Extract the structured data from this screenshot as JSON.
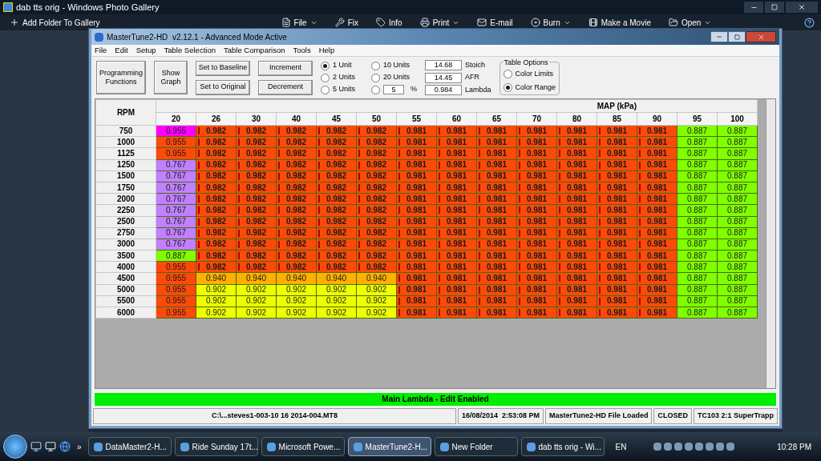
{
  "gallery": {
    "title": "dab tts orig - Windows Photo Gallery",
    "toolbar": [
      {
        "label": "Add Folder To Gallery",
        "kind": "add",
        "has_menu": false
      },
      {
        "label": "File",
        "kind": "file",
        "has_menu": true
      },
      {
        "label": "Fix",
        "kind": "fix",
        "has_menu": false
      },
      {
        "label": "Info",
        "kind": "info",
        "has_menu": false
      },
      {
        "label": "Print",
        "kind": "print",
        "has_menu": true
      },
      {
        "label": "E-mail",
        "kind": "mail",
        "has_menu": false
      },
      {
        "label": "Burn",
        "kind": "burn",
        "has_menu": true
      },
      {
        "label": "Make a Movie",
        "kind": "movie",
        "has_menu": false
      },
      {
        "label": "Open",
        "kind": "open",
        "has_menu": true
      }
    ]
  },
  "window": {
    "title": "MasterTune2-HD  v2.12.1 - Advanced Mode Active",
    "menu": [
      "File",
      "Edit",
      "Setup",
      "Table Selection",
      "Table Comparison",
      "Tools",
      "Help"
    ],
    "big_buttons": [
      "Programming Functions",
      "Show Graph"
    ],
    "buttons_a": [
      "Set to Baseline",
      "Set to Original"
    ],
    "buttons_b": [
      "Increment",
      "Decrement"
    ],
    "units": [
      {
        "label": "1 Unit",
        "selected": true
      },
      {
        "label": "2 Units",
        "selected": false
      },
      {
        "label": "5 Units",
        "selected": false
      },
      {
        "label": "10 Units",
        "selected": false
      },
      {
        "label": "20 Units",
        "selected": false
      }
    ],
    "percent": {
      "selected": false,
      "value": "5",
      "unit": "%"
    },
    "readouts": [
      {
        "value": "14.68",
        "label": "Stoich"
      },
      {
        "value": "14.45",
        "label": "AFR"
      },
      {
        "value": "0.984",
        "label": "Lambda"
      }
    ],
    "table_options": {
      "title": "Table Options",
      "options": [
        {
          "label": "Color Limits",
          "selected": false
        },
        {
          "label": "Color Range",
          "selected": true
        }
      ]
    }
  },
  "table": {
    "row_header": "RPM",
    "column_group": "MAP (kPa)",
    "columns": [
      "20",
      "26",
      "30",
      "40",
      "45",
      "50",
      "55",
      "60",
      "65",
      "70",
      "80",
      "85",
      "90",
      "95",
      "100"
    ],
    "rows": [
      {
        "rpm": "750",
        "cells": [
          {
            "value": "0.955",
            "color": "#ff00ff",
            "marked": false
          },
          {
            "value": "0.982",
            "color": "#fc4a0a",
            "marked": true
          },
          {
            "value": "0.982",
            "color": "#fc4a0a",
            "marked": true
          },
          {
            "value": "0.982",
            "color": "#fc4a0a",
            "marked": true
          },
          {
            "value": "0.982",
            "color": "#fc4a0a",
            "marked": true
          },
          {
            "value": "0.982",
            "color": "#fc4a0a",
            "marked": true
          },
          {
            "value": "0.981",
            "color": "#fc4a0a",
            "marked": true
          },
          {
            "value": "0.981",
            "color": "#fc4a0a",
            "marked": true
          },
          {
            "value": "0.981",
            "color": "#fc4a0a",
            "marked": true
          },
          {
            "value": "0.981",
            "color": "#fc4a0a",
            "marked": true
          },
          {
            "value": "0.981",
            "color": "#fc4a0a",
            "marked": true
          },
          {
            "value": "0.981",
            "color": "#fc4a0a",
            "marked": true
          },
          {
            "value": "0.981",
            "color": "#fc4a0a",
            "marked": true
          },
          {
            "value": "0.887",
            "color": "#80ff00",
            "marked": false
          },
          {
            "value": "0.887",
            "color": "#80ff00",
            "marked": false
          }
        ]
      },
      {
        "rpm": "1000",
        "cells": [
          {
            "value": "0.955",
            "color": "#fc4a0a",
            "marked": false
          },
          {
            "value": "0.982",
            "color": "#fc4a0a",
            "marked": true
          },
          {
            "value": "0.982",
            "color": "#fc4a0a",
            "marked": true
          },
          {
            "value": "0.982",
            "color": "#fc4a0a",
            "marked": true
          },
          {
            "value": "0.982",
            "color": "#fc4a0a",
            "marked": true
          },
          {
            "value": "0.982",
            "color": "#fc4a0a",
            "marked": true
          },
          {
            "value": "0.981",
            "color": "#fc4a0a",
            "marked": true
          },
          {
            "value": "0.981",
            "color": "#fc4a0a",
            "marked": true
          },
          {
            "value": "0.981",
            "color": "#fc4a0a",
            "marked": true
          },
          {
            "value": "0.981",
            "color": "#fc4a0a",
            "marked": true
          },
          {
            "value": "0.981",
            "color": "#fc4a0a",
            "marked": true
          },
          {
            "value": "0.981",
            "color": "#fc4a0a",
            "marked": true
          },
          {
            "value": "0.981",
            "color": "#fc4a0a",
            "marked": true
          },
          {
            "value": "0.887",
            "color": "#80ff00",
            "marked": false
          },
          {
            "value": "0.887",
            "color": "#80ff00",
            "marked": false
          }
        ]
      },
      {
        "rpm": "1125",
        "cells": [
          {
            "value": "0.955",
            "color": "#fc4a0a",
            "marked": false
          },
          {
            "value": "0.982",
            "color": "#fc4a0a",
            "marked": true
          },
          {
            "value": "0.982",
            "color": "#fc4a0a",
            "marked": true
          },
          {
            "value": "0.982",
            "color": "#fc4a0a",
            "marked": true
          },
          {
            "value": "0.982",
            "color": "#fc4a0a",
            "marked": true
          },
          {
            "value": "0.982",
            "color": "#fc4a0a",
            "marked": true
          },
          {
            "value": "0.981",
            "color": "#fc4a0a",
            "marked": true
          },
          {
            "value": "0.981",
            "color": "#fc4a0a",
            "marked": true
          },
          {
            "value": "0.981",
            "color": "#fc4a0a",
            "marked": true
          },
          {
            "value": "0.981",
            "color": "#fc4a0a",
            "marked": true
          },
          {
            "value": "0.981",
            "color": "#fc4a0a",
            "marked": true
          },
          {
            "value": "0.981",
            "color": "#fc4a0a",
            "marked": true
          },
          {
            "value": "0.981",
            "color": "#fc4a0a",
            "marked": true
          },
          {
            "value": "0.887",
            "color": "#80ff00",
            "marked": false
          },
          {
            "value": "0.887",
            "color": "#80ff00",
            "marked": false
          }
        ]
      },
      {
        "rpm": "1250",
        "cells": [
          {
            "value": "0.767",
            "color": "#c080ff",
            "marked": false
          },
          {
            "value": "0.982",
            "color": "#fc4a0a",
            "marked": true
          },
          {
            "value": "0.982",
            "color": "#fc4a0a",
            "marked": true
          },
          {
            "value": "0.982",
            "color": "#fc4a0a",
            "marked": true
          },
          {
            "value": "0.982",
            "color": "#fc4a0a",
            "marked": true
          },
          {
            "value": "0.982",
            "color": "#fc4a0a",
            "marked": true
          },
          {
            "value": "0.981",
            "color": "#fc4a0a",
            "marked": true
          },
          {
            "value": "0.981",
            "color": "#fc4a0a",
            "marked": true
          },
          {
            "value": "0.981",
            "color": "#fc4a0a",
            "marked": true
          },
          {
            "value": "0.981",
            "color": "#fc4a0a",
            "marked": true
          },
          {
            "value": "0.981",
            "color": "#fc4a0a",
            "marked": true
          },
          {
            "value": "0.981",
            "color": "#fc4a0a",
            "marked": true
          },
          {
            "value": "0.981",
            "color": "#fc4a0a",
            "marked": true
          },
          {
            "value": "0.887",
            "color": "#80ff00",
            "marked": false
          },
          {
            "value": "0.887",
            "color": "#80ff00",
            "marked": false
          }
        ]
      },
      {
        "rpm": "1500",
        "cells": [
          {
            "value": "0.767",
            "color": "#c080ff",
            "marked": false
          },
          {
            "value": "0.982",
            "color": "#fc4a0a",
            "marked": true
          },
          {
            "value": "0.982",
            "color": "#fc4a0a",
            "marked": true
          },
          {
            "value": "0.982",
            "color": "#fc4a0a",
            "marked": true
          },
          {
            "value": "0.982",
            "color": "#fc4a0a",
            "marked": true
          },
          {
            "value": "0.982",
            "color": "#fc4a0a",
            "marked": true
          },
          {
            "value": "0.981",
            "color": "#fc4a0a",
            "marked": true
          },
          {
            "value": "0.981",
            "color": "#fc4a0a",
            "marked": true
          },
          {
            "value": "0.981",
            "color": "#fc4a0a",
            "marked": true
          },
          {
            "value": "0.981",
            "color": "#fc4a0a",
            "marked": true
          },
          {
            "value": "0.981",
            "color": "#fc4a0a",
            "marked": true
          },
          {
            "value": "0.981",
            "color": "#fc4a0a",
            "marked": true
          },
          {
            "value": "0.981",
            "color": "#fc4a0a",
            "marked": true
          },
          {
            "value": "0.887",
            "color": "#80ff00",
            "marked": false
          },
          {
            "value": "0.887",
            "color": "#80ff00",
            "marked": false
          }
        ]
      },
      {
        "rpm": "1750",
        "cells": [
          {
            "value": "0.767",
            "color": "#c080ff",
            "marked": false
          },
          {
            "value": "0.982",
            "color": "#fc4a0a",
            "marked": true
          },
          {
            "value": "0.982",
            "color": "#fc4a0a",
            "marked": true
          },
          {
            "value": "0.982",
            "color": "#fc4a0a",
            "marked": true
          },
          {
            "value": "0.982",
            "color": "#fc4a0a",
            "marked": true
          },
          {
            "value": "0.982",
            "color": "#fc4a0a",
            "marked": true
          },
          {
            "value": "0.981",
            "color": "#fc4a0a",
            "marked": true
          },
          {
            "value": "0.981",
            "color": "#fc4a0a",
            "marked": true
          },
          {
            "value": "0.981",
            "color": "#fc4a0a",
            "marked": true
          },
          {
            "value": "0.981",
            "color": "#fc4a0a",
            "marked": true
          },
          {
            "value": "0.981",
            "color": "#fc4a0a",
            "marked": true
          },
          {
            "value": "0.981",
            "color": "#fc4a0a",
            "marked": true
          },
          {
            "value": "0.981",
            "color": "#fc4a0a",
            "marked": true
          },
          {
            "value": "0.887",
            "color": "#80ff00",
            "marked": false
          },
          {
            "value": "0.887",
            "color": "#80ff00",
            "marked": false
          }
        ]
      },
      {
        "rpm": "2000",
        "cells": [
          {
            "value": "0.767",
            "color": "#c080ff",
            "marked": false
          },
          {
            "value": "0.982",
            "color": "#fc4a0a",
            "marked": true
          },
          {
            "value": "0.982",
            "color": "#fc4a0a",
            "marked": true
          },
          {
            "value": "0.982",
            "color": "#fc4a0a",
            "marked": true
          },
          {
            "value": "0.982",
            "color": "#fc4a0a",
            "marked": true
          },
          {
            "value": "0.982",
            "color": "#fc4a0a",
            "marked": true
          },
          {
            "value": "0.981",
            "color": "#fc4a0a",
            "marked": true
          },
          {
            "value": "0.981",
            "color": "#fc4a0a",
            "marked": true
          },
          {
            "value": "0.981",
            "color": "#fc4a0a",
            "marked": true
          },
          {
            "value": "0.981",
            "color": "#fc4a0a",
            "marked": true
          },
          {
            "value": "0.981",
            "color": "#fc4a0a",
            "marked": true
          },
          {
            "value": "0.981",
            "color": "#fc4a0a",
            "marked": true
          },
          {
            "value": "0.981",
            "color": "#fc4a0a",
            "marked": true
          },
          {
            "value": "0.887",
            "color": "#80ff00",
            "marked": false
          },
          {
            "value": "0.887",
            "color": "#80ff00",
            "marked": false
          }
        ]
      },
      {
        "rpm": "2250",
        "cells": [
          {
            "value": "0.767",
            "color": "#c080ff",
            "marked": false
          },
          {
            "value": "0.982",
            "color": "#fc4a0a",
            "marked": true
          },
          {
            "value": "0.982",
            "color": "#fc4a0a",
            "marked": true
          },
          {
            "value": "0.982",
            "color": "#fc4a0a",
            "marked": true
          },
          {
            "value": "0.982",
            "color": "#fc4a0a",
            "marked": true
          },
          {
            "value": "0.982",
            "color": "#fc4a0a",
            "marked": true
          },
          {
            "value": "0.981",
            "color": "#fc4a0a",
            "marked": true
          },
          {
            "value": "0.981",
            "color": "#fc4a0a",
            "marked": true
          },
          {
            "value": "0.981",
            "color": "#fc4a0a",
            "marked": true
          },
          {
            "value": "0.981",
            "color": "#fc4a0a",
            "marked": true
          },
          {
            "value": "0.981",
            "color": "#fc4a0a",
            "marked": true
          },
          {
            "value": "0.981",
            "color": "#fc4a0a",
            "marked": true
          },
          {
            "value": "0.981",
            "color": "#fc4a0a",
            "marked": true
          },
          {
            "value": "0.887",
            "color": "#80ff00",
            "marked": false
          },
          {
            "value": "0.887",
            "color": "#80ff00",
            "marked": false
          }
        ]
      },
      {
        "rpm": "2500",
        "cells": [
          {
            "value": "0.767",
            "color": "#c080ff",
            "marked": false
          },
          {
            "value": "0.982",
            "color": "#fc4a0a",
            "marked": true
          },
          {
            "value": "0.982",
            "color": "#fc4a0a",
            "marked": true
          },
          {
            "value": "0.982",
            "color": "#fc4a0a",
            "marked": true
          },
          {
            "value": "0.982",
            "color": "#fc4a0a",
            "marked": true
          },
          {
            "value": "0.982",
            "color": "#fc4a0a",
            "marked": true
          },
          {
            "value": "0.981",
            "color": "#fc4a0a",
            "marked": true
          },
          {
            "value": "0.981",
            "color": "#fc4a0a",
            "marked": true
          },
          {
            "value": "0.981",
            "color": "#fc4a0a",
            "marked": true
          },
          {
            "value": "0.981",
            "color": "#fc4a0a",
            "marked": true
          },
          {
            "value": "0.981",
            "color": "#fc4a0a",
            "marked": true
          },
          {
            "value": "0.981",
            "color": "#fc4a0a",
            "marked": true
          },
          {
            "value": "0.981",
            "color": "#fc4a0a",
            "marked": true
          },
          {
            "value": "0.887",
            "color": "#80ff00",
            "marked": false
          },
          {
            "value": "0.887",
            "color": "#80ff00",
            "marked": false
          }
        ]
      },
      {
        "rpm": "2750",
        "cells": [
          {
            "value": "0.767",
            "color": "#c080ff",
            "marked": false
          },
          {
            "value": "0.982",
            "color": "#fc4a0a",
            "marked": true
          },
          {
            "value": "0.982",
            "color": "#fc4a0a",
            "marked": true
          },
          {
            "value": "0.982",
            "color": "#fc4a0a",
            "marked": true
          },
          {
            "value": "0.982",
            "color": "#fc4a0a",
            "marked": true
          },
          {
            "value": "0.982",
            "color": "#fc4a0a",
            "marked": true
          },
          {
            "value": "0.981",
            "color": "#fc4a0a",
            "marked": true
          },
          {
            "value": "0.981",
            "color": "#fc4a0a",
            "marked": true
          },
          {
            "value": "0.981",
            "color": "#fc4a0a",
            "marked": true
          },
          {
            "value": "0.981",
            "color": "#fc4a0a",
            "marked": true
          },
          {
            "value": "0.981",
            "color": "#fc4a0a",
            "marked": true
          },
          {
            "value": "0.981",
            "color": "#fc4a0a",
            "marked": true
          },
          {
            "value": "0.981",
            "color": "#fc4a0a",
            "marked": true
          },
          {
            "value": "0.887",
            "color": "#80ff00",
            "marked": false
          },
          {
            "value": "0.887",
            "color": "#80ff00",
            "marked": false
          }
        ]
      },
      {
        "rpm": "3000",
        "cells": [
          {
            "value": "0.767",
            "color": "#c080ff",
            "marked": false
          },
          {
            "value": "0.982",
            "color": "#fc4a0a",
            "marked": true
          },
          {
            "value": "0.982",
            "color": "#fc4a0a",
            "marked": true
          },
          {
            "value": "0.982",
            "color": "#fc4a0a",
            "marked": true
          },
          {
            "value": "0.982",
            "color": "#fc4a0a",
            "marked": true
          },
          {
            "value": "0.982",
            "color": "#fc4a0a",
            "marked": true
          },
          {
            "value": "0.981",
            "color": "#fc4a0a",
            "marked": true
          },
          {
            "value": "0.981",
            "color": "#fc4a0a",
            "marked": true
          },
          {
            "value": "0.981",
            "color": "#fc4a0a",
            "marked": true
          },
          {
            "value": "0.981",
            "color": "#fc4a0a",
            "marked": true
          },
          {
            "value": "0.981",
            "color": "#fc4a0a",
            "marked": true
          },
          {
            "value": "0.981",
            "color": "#fc4a0a",
            "marked": true
          },
          {
            "value": "0.981",
            "color": "#fc4a0a",
            "marked": true
          },
          {
            "value": "0.887",
            "color": "#80ff00",
            "marked": false
          },
          {
            "value": "0.887",
            "color": "#80ff00",
            "marked": false
          }
        ]
      },
      {
        "rpm": "3500",
        "cells": [
          {
            "value": "0.887",
            "color": "#80ff00",
            "marked": false
          },
          {
            "value": "0.982",
            "color": "#fc4a0a",
            "marked": true
          },
          {
            "value": "0.982",
            "color": "#fc4a0a",
            "marked": true
          },
          {
            "value": "0.982",
            "color": "#fc4a0a",
            "marked": true
          },
          {
            "value": "0.982",
            "color": "#fc4a0a",
            "marked": true
          },
          {
            "value": "0.982",
            "color": "#fc4a0a",
            "marked": true
          },
          {
            "value": "0.981",
            "color": "#fc4a0a",
            "marked": true
          },
          {
            "value": "0.981",
            "color": "#fc4a0a",
            "marked": true
          },
          {
            "value": "0.981",
            "color": "#fc4a0a",
            "marked": true
          },
          {
            "value": "0.981",
            "color": "#fc4a0a",
            "marked": true
          },
          {
            "value": "0.981",
            "color": "#fc4a0a",
            "marked": true
          },
          {
            "value": "0.981",
            "color": "#fc4a0a",
            "marked": true
          },
          {
            "value": "0.981",
            "color": "#fc4a0a",
            "marked": true
          },
          {
            "value": "0.887",
            "color": "#80ff00",
            "marked": false
          },
          {
            "value": "0.887",
            "color": "#80ff00",
            "marked": false
          }
        ]
      },
      {
        "rpm": "4000",
        "cells": [
          {
            "value": "0.955",
            "color": "#fc4a0a",
            "marked": false
          },
          {
            "value": "0.982",
            "color": "#fc4a0a",
            "marked": true
          },
          {
            "value": "0.982",
            "color": "#fc4a0a",
            "marked": true
          },
          {
            "value": "0.982",
            "color": "#fc4a0a",
            "marked": true
          },
          {
            "value": "0.982",
            "color": "#fc4a0a",
            "marked": true
          },
          {
            "value": "0.982",
            "color": "#fc4a0a",
            "marked": true
          },
          {
            "value": "0.981",
            "color": "#fc4a0a",
            "marked": true
          },
          {
            "value": "0.981",
            "color": "#fc4a0a",
            "marked": true
          },
          {
            "value": "0.981",
            "color": "#fc4a0a",
            "marked": true
          },
          {
            "value": "0.981",
            "color": "#fc4a0a",
            "marked": true
          },
          {
            "value": "0.981",
            "color": "#fc4a0a",
            "marked": true
          },
          {
            "value": "0.981",
            "color": "#fc4a0a",
            "marked": true
          },
          {
            "value": "0.981",
            "color": "#fc4a0a",
            "marked": true
          },
          {
            "value": "0.887",
            "color": "#80ff00",
            "marked": false
          },
          {
            "value": "0.887",
            "color": "#80ff00",
            "marked": false
          }
        ]
      },
      {
        "rpm": "4500",
        "cells": [
          {
            "value": "0.955",
            "color": "#fc4a0a",
            "marked": false
          },
          {
            "value": "0.940",
            "color": "#ffb000",
            "marked": false
          },
          {
            "value": "0.940",
            "color": "#ffb000",
            "marked": false
          },
          {
            "value": "0.940",
            "color": "#ffb000",
            "marked": false
          },
          {
            "value": "0.940",
            "color": "#ffb000",
            "marked": false
          },
          {
            "value": "0.940",
            "color": "#ffb000",
            "marked": false
          },
          {
            "value": "0.981",
            "color": "#fc4a0a",
            "marked": true
          },
          {
            "value": "0.981",
            "color": "#fc4a0a",
            "marked": true
          },
          {
            "value": "0.981",
            "color": "#fc4a0a",
            "marked": true
          },
          {
            "value": "0.981",
            "color": "#fc4a0a",
            "marked": true
          },
          {
            "value": "0.981",
            "color": "#fc4a0a",
            "marked": true
          },
          {
            "value": "0.981",
            "color": "#fc4a0a",
            "marked": true
          },
          {
            "value": "0.981",
            "color": "#fc4a0a",
            "marked": true
          },
          {
            "value": "0.887",
            "color": "#80ff00",
            "marked": false
          },
          {
            "value": "0.887",
            "color": "#80ff00",
            "marked": false
          }
        ]
      },
      {
        "rpm": "5000",
        "cells": [
          {
            "value": "0.955",
            "color": "#fc4a0a",
            "marked": false
          },
          {
            "value": "0.902",
            "color": "#eeff00",
            "marked": false
          },
          {
            "value": "0.902",
            "color": "#eeff00",
            "marked": false
          },
          {
            "value": "0.902",
            "color": "#eeff00",
            "marked": false
          },
          {
            "value": "0.902",
            "color": "#eeff00",
            "marked": false
          },
          {
            "value": "0.902",
            "color": "#eeff00",
            "marked": false
          },
          {
            "value": "0.981",
            "color": "#fc4a0a",
            "marked": true
          },
          {
            "value": "0.981",
            "color": "#fc4a0a",
            "marked": true
          },
          {
            "value": "0.981",
            "color": "#fc4a0a",
            "marked": true
          },
          {
            "value": "0.981",
            "color": "#fc4a0a",
            "marked": true
          },
          {
            "value": "0.981",
            "color": "#fc4a0a",
            "marked": true
          },
          {
            "value": "0.981",
            "color": "#fc4a0a",
            "marked": true
          },
          {
            "value": "0.981",
            "color": "#fc4a0a",
            "marked": true
          },
          {
            "value": "0.887",
            "color": "#80ff00",
            "marked": false
          },
          {
            "value": "0.887",
            "color": "#80ff00",
            "marked": false
          }
        ]
      },
      {
        "rpm": "5500",
        "cells": [
          {
            "value": "0.955",
            "color": "#fc4a0a",
            "marked": false
          },
          {
            "value": "0.902",
            "color": "#eeff00",
            "marked": false
          },
          {
            "value": "0.902",
            "color": "#eeff00",
            "marked": false
          },
          {
            "value": "0.902",
            "color": "#eeff00",
            "marked": false
          },
          {
            "value": "0.902",
            "color": "#eeff00",
            "marked": false
          },
          {
            "value": "0.902",
            "color": "#eeff00",
            "marked": false
          },
          {
            "value": "0.981",
            "color": "#fc4a0a",
            "marked": true
          },
          {
            "value": "0.981",
            "color": "#fc4a0a",
            "marked": true
          },
          {
            "value": "0.981",
            "color": "#fc4a0a",
            "marked": true
          },
          {
            "value": "0.981",
            "color": "#fc4a0a",
            "marked": true
          },
          {
            "value": "0.981",
            "color": "#fc4a0a",
            "marked": true
          },
          {
            "value": "0.981",
            "color": "#fc4a0a",
            "marked": true
          },
          {
            "value": "0.981",
            "color": "#fc4a0a",
            "marked": true
          },
          {
            "value": "0.887",
            "color": "#80ff00",
            "marked": false
          },
          {
            "value": "0.887",
            "color": "#80ff00",
            "marked": false
          }
        ]
      },
      {
        "rpm": "6000",
        "cells": [
          {
            "value": "0.955",
            "color": "#fc4a0a",
            "marked": false
          },
          {
            "value": "0.902",
            "color": "#eeff00",
            "marked": false
          },
          {
            "value": "0.902",
            "color": "#eeff00",
            "marked": false
          },
          {
            "value": "0.902",
            "color": "#eeff00",
            "marked": false
          },
          {
            "value": "0.902",
            "color": "#eeff00",
            "marked": false
          },
          {
            "value": "0.902",
            "color": "#eeff00",
            "marked": false
          },
          {
            "value": "0.981",
            "color": "#fc4a0a",
            "marked": true
          },
          {
            "value": "0.981",
            "color": "#fc4a0a",
            "marked": true
          },
          {
            "value": "0.981",
            "color": "#fc4a0a",
            "marked": true
          },
          {
            "value": "0.981",
            "color": "#fc4a0a",
            "marked": true
          },
          {
            "value": "0.981",
            "color": "#fc4a0a",
            "marked": true
          },
          {
            "value": "0.981",
            "color": "#fc4a0a",
            "marked": true
          },
          {
            "value": "0.981",
            "color": "#fc4a0a",
            "marked": true
          },
          {
            "value": "0.887",
            "color": "#80ff00",
            "marked": false
          },
          {
            "value": "0.887",
            "color": "#80ff00",
            "marked": false
          }
        ]
      }
    ]
  },
  "banner": "Main Lambda - Edit Enabled",
  "status_bar": [
    "C:\\...steves1-003-10 16 2014-004.MT8",
    "16/08/2014  2:53:08 PM",
    "MasterTune2-HD File Loaded",
    "CLOSED",
    "TC103 2:1 SuperTrapp"
  ],
  "taskbar": {
    "items": [
      {
        "label": "DataMaster2-H...",
        "selected": false
      },
      {
        "label": "Ride Sunday 17t...",
        "selected": false
      },
      {
        "label": "Microsoft Powe...",
        "selected": false
      },
      {
        "label": "MasterTune2-H...",
        "selected": true
      },
      {
        "label": "New Folder",
        "selected": false
      },
      {
        "label": "dab tts orig - Wi...",
        "selected": false
      }
    ],
    "overflow": "»",
    "language": "EN",
    "clock": "10:28 PM"
  }
}
